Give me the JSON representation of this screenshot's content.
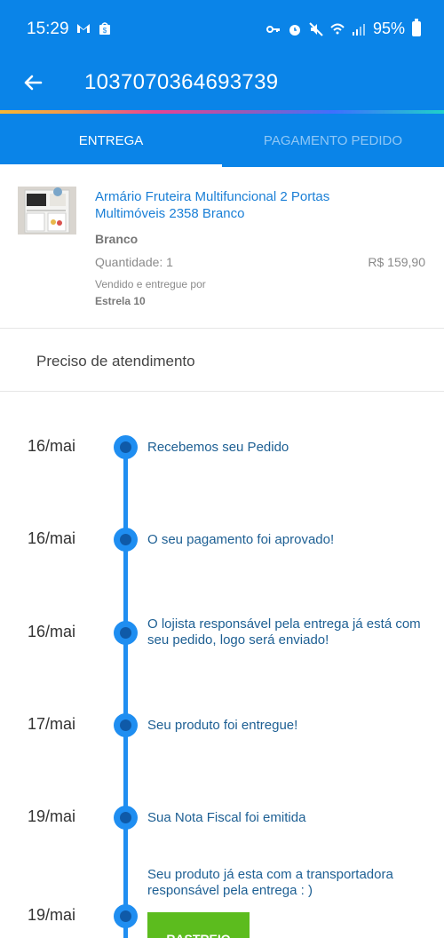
{
  "status_bar": {
    "time": "15:29",
    "battery": "95%"
  },
  "header": {
    "order_number": "1037070364693739"
  },
  "tabs": [
    {
      "label": "ENTREGA",
      "active": true
    },
    {
      "label": "PAGAMENTO PEDIDO",
      "active": false
    }
  ],
  "product": {
    "name": "Armário Fruteira Multifuncional 2 Portas Multimóveis 2358 Branco",
    "variant": "Branco",
    "quantity": "Quantidade: 1",
    "price": "R$ 159,90",
    "seller_label": "Vendido e entregue por",
    "seller_name": "Estrela 10"
  },
  "help": {
    "label": "Preciso de atendimento"
  },
  "timeline": [
    {
      "date": "16/mai",
      "text": "Recebemos seu Pedido"
    },
    {
      "date": "16/mai",
      "text": "O seu pagamento foi aprovado!"
    },
    {
      "date": "16/mai",
      "text": "O lojista responsável pela entrega já está com seu pedido, logo será enviado!"
    },
    {
      "date": "17/mai",
      "text": "Seu produto foi entregue!"
    },
    {
      "date": "19/mai",
      "text": "Sua Nota Fiscal foi emitida"
    },
    {
      "date": "19/mai",
      "text": "Seu produto já esta com a transportadora responsável pela entrega : )"
    }
  ],
  "tracking_button": {
    "label": "RASTREIO"
  },
  "colors": {
    "primary": "#0a84e8",
    "timeline": "#1f8ef1",
    "link": "#1a7fd6",
    "button": "#5cbc1e"
  }
}
